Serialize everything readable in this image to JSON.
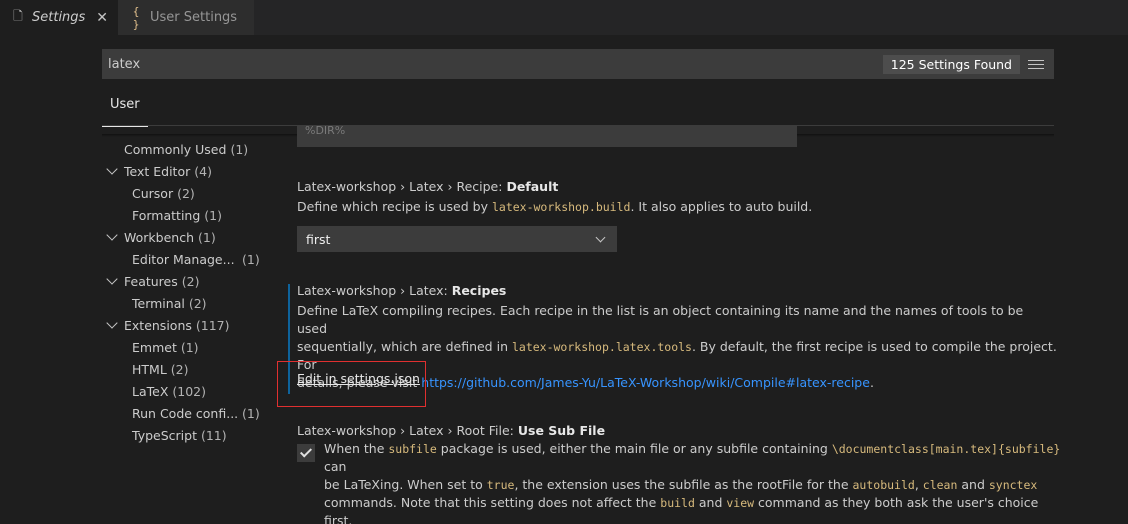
{
  "tabs": [
    {
      "label": "Settings",
      "icon": "file-icon"
    },
    {
      "label": "User Settings",
      "icon": "braces-icon"
    }
  ],
  "search": {
    "value": "latex",
    "found_label": "125 Settings Found"
  },
  "scope": {
    "user_label": "User"
  },
  "toc": [
    {
      "label": "Commonly Used",
      "count": "(1)"
    },
    {
      "label": "Text Editor",
      "count": "(4)"
    },
    {
      "label": "Cursor",
      "count": "(2)"
    },
    {
      "label": "Formatting",
      "count": "(1)"
    },
    {
      "label": "Workbench",
      "count": "(1)"
    },
    {
      "label": "Editor Manage...",
      "count": "(1)"
    },
    {
      "label": "Features",
      "count": "(2)"
    },
    {
      "label": "Terminal",
      "count": "(2)"
    },
    {
      "label": "Extensions",
      "count": "(117)"
    },
    {
      "label": "Emmet",
      "count": "(1)"
    },
    {
      "label": "HTML",
      "count": "(2)"
    },
    {
      "label": "LaTeX",
      "count": "(102)"
    },
    {
      "label": "Run Code confi...",
      "count": "(1)"
    },
    {
      "label": "TypeScript",
      "count": "(11)"
    }
  ],
  "residual_input": "%DIR%",
  "recipe_default": {
    "category": "Latex-workshop › Latex › Recipe: ",
    "key": "Default",
    "desc_before": "Define which recipe is used by ",
    "desc_code": "latex-workshop.build",
    "desc_after": ". It also applies to auto build.",
    "select_value": "first"
  },
  "recipes": {
    "category": "Latex-workshop › Latex: ",
    "key": "Recipes",
    "desc_1": "Define LaTeX compiling recipes. Each recipe in the list is an object containing its name and the names of tools to be used",
    "desc_2_before": "sequentially, which are defined in ",
    "desc_2_code": "latex-workshop.latex.tools",
    "desc_2_after": ". By default, the first recipe is used to compile the project. For",
    "desc_3_before": "details, please visit ",
    "desc_3_link": "https://github.com/James-Yu/LaTeX-Workshop/wiki/Compile#latex-recipe",
    "desc_3_after": ".",
    "edit_label": "Edit in settings.json"
  },
  "root_file": {
    "category": "Latex-workshop › Latex › Root File: ",
    "key": "Use Sub File",
    "checked": true,
    "l1_a": "When the ",
    "l1_code1": "subfile",
    "l1_b": " package is used, either the main file or any subfile containing ",
    "l1_code2": "\\documentclass[main.tex]{subfile}",
    "l1_c": " can",
    "l2_a": "be LaTeXing. When set to ",
    "l2_code1": "true",
    "l2_b": ", the extension uses the subfile as the rootFile for the ",
    "l2_code2": "autobuild",
    "l2_c": ", ",
    "l2_code3": "clean",
    "l2_d": " and ",
    "l2_code4": "synctex",
    "l3_a": "commands. Note that this setting does not affect the ",
    "l3_code1": "build",
    "l3_b": " and ",
    "l3_code2": "view",
    "l3_c": " command as they both ask the user's choice first."
  },
  "colors": {
    "background": "#1e1e1e",
    "link": "#3794ff",
    "code": "#d7ba7d",
    "highlight_box": "#e03030"
  }
}
